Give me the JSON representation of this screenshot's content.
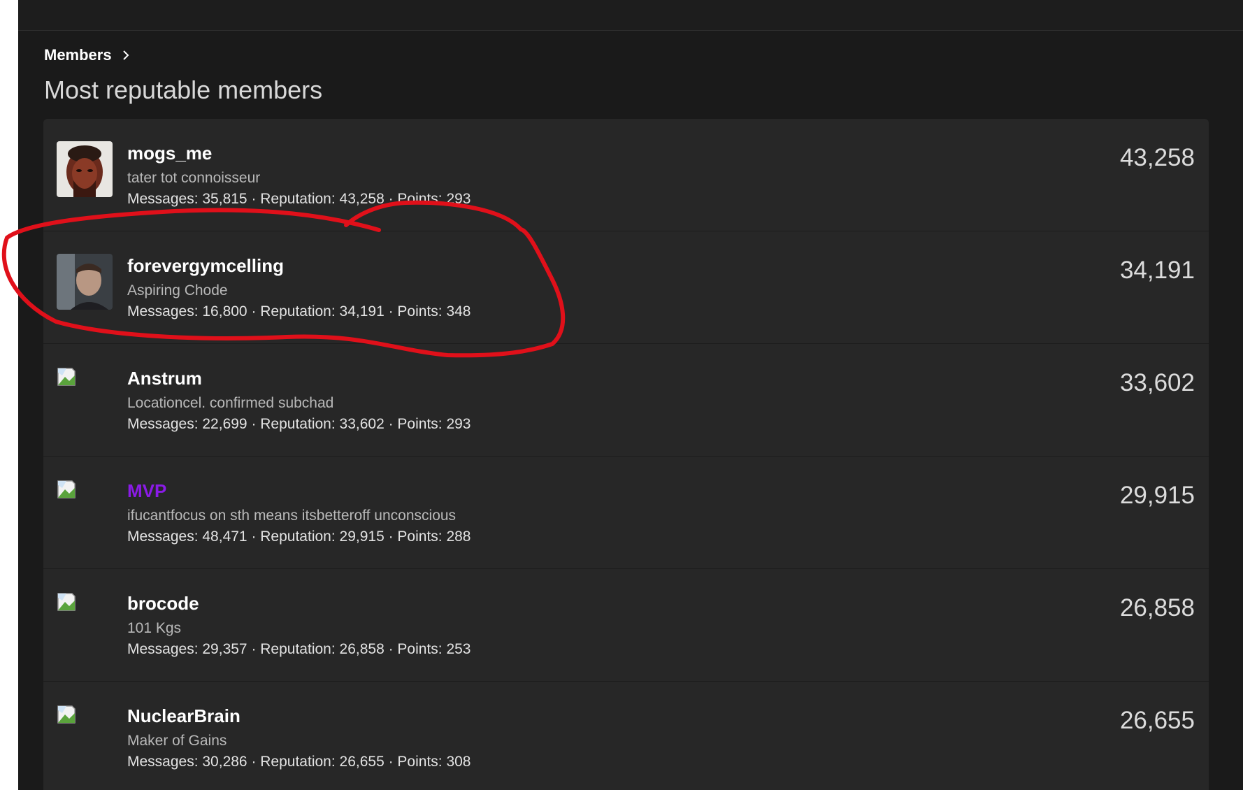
{
  "breadcrumb": {
    "label": "Members"
  },
  "page": {
    "title": "Most reputable members"
  },
  "colors": {
    "mvp_name": "#8a1be6",
    "annotation": "#e0101a"
  },
  "members": [
    {
      "name": "mogs_me",
      "title": "tater tot connoisseur",
      "stats": "Messages: 35,815 · Reputation: 43,258 · Points: 293",
      "score": "43,258",
      "avatar": "photo"
    },
    {
      "name": "forevergymcelling",
      "title": "Aspiring Chode",
      "stats": "Messages: 16,800 · Reputation: 34,191 · Points: 348",
      "score": "34,191",
      "avatar": "photo"
    },
    {
      "name": "Anstrum",
      "title": "Locationcel. confirmed subchad",
      "stats": "Messages: 22,699 · Reputation: 33,602 · Points: 293",
      "score": "33,602",
      "avatar": "broken-image-icon"
    },
    {
      "name": "MVP",
      "title": "ifucantfocus on sth means itsbetteroff unconscious",
      "stats": "Messages: 48,471 · Reputation: 29,915 · Points: 288",
      "score": "29,915",
      "avatar": "broken-image-icon"
    },
    {
      "name": "brocode",
      "title": "101 Kgs",
      "stats": "Messages: 29,357 · Reputation: 26,858 · Points: 253",
      "score": "26,858",
      "avatar": "broken-image-icon"
    },
    {
      "name": "NuclearBrain",
      "title": "Maker of Gains",
      "stats": "Messages: 30,286 · Reputation: 26,655 · Points: 308",
      "score": "26,655",
      "avatar": "broken-image-icon"
    }
  ]
}
